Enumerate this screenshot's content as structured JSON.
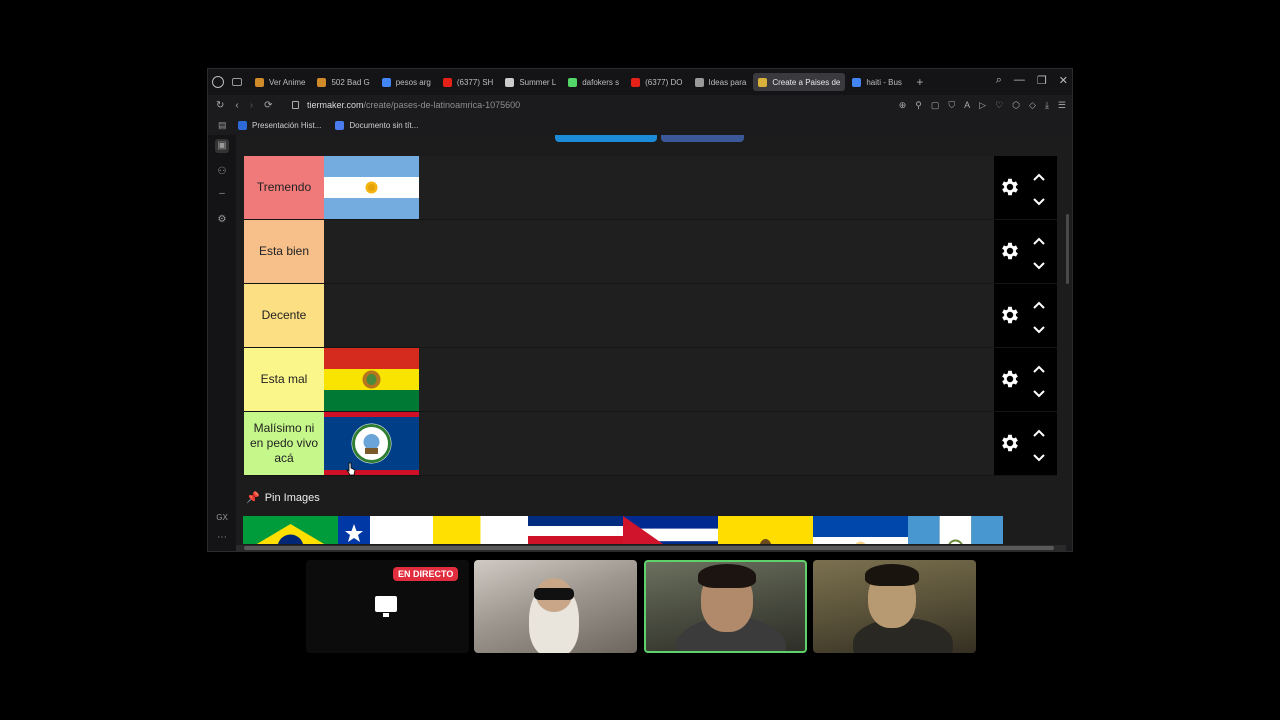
{
  "browser": {
    "tabs": [
      {
        "label": "Ver Anime",
        "color": "#d08a2a"
      },
      {
        "label": "502 Bad G",
        "color": "#d08a2a"
      },
      {
        "label": "pesos arg",
        "color": "#4285f4"
      },
      {
        "label": "(6377) SH",
        "color": "#e62117"
      },
      {
        "label": "Summer L",
        "color": "#cccccc"
      },
      {
        "label": "dafokers s",
        "color": "#53d769"
      },
      {
        "label": "(6377) DO",
        "color": "#e62117"
      },
      {
        "label": "Ideas para",
        "color": "#999999"
      },
      {
        "label": "Create a Paises de",
        "color": "#d8b13a"
      },
      {
        "label": "haiti - Bus",
        "color": "#4285f4"
      }
    ],
    "url_domain": "tiermaker.com",
    "url_path": "/create/pases-de-latinoamrica-1075600",
    "bookmarks": [
      {
        "label": "Presentación Hist...",
        "color": "#2d6ad8"
      },
      {
        "label": "Documento sin tít...",
        "color": "#4a7cf0"
      }
    ]
  },
  "tiers": [
    {
      "label": "Tremendo",
      "color": "#f07a7a",
      "items": [
        "argentina"
      ]
    },
    {
      "label": "Esta bien",
      "color": "#f7bf8a",
      "items": []
    },
    {
      "label": "Decente",
      "color": "#fbdf82",
      "items": []
    },
    {
      "label": "Esta mal",
      "color": "#fbf68a",
      "items": [
        "bolivia"
      ]
    },
    {
      "label": "Malísimo ni en pedo vivo acá",
      "color": "#c6f78a",
      "items": [
        "belize"
      ]
    }
  ],
  "pin": {
    "label": "Pin Images",
    "icon": "pin-icon"
  },
  "pool": [
    "brazil",
    "chile",
    "vatican",
    "costa-rica",
    "cuba",
    "ecuador",
    "el-salvador",
    "guatemala"
  ],
  "stream": {
    "live_badge": "EN DIRECTO"
  }
}
